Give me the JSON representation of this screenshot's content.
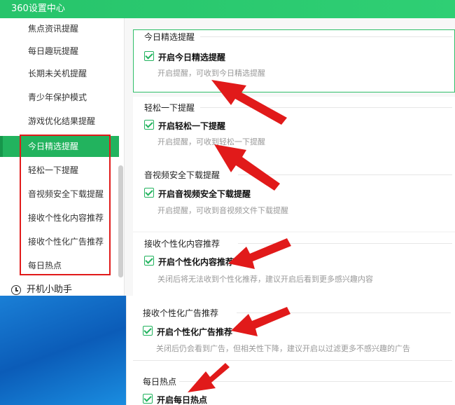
{
  "window": {
    "title": "360设置中心"
  },
  "sidebar": {
    "items": [
      {
        "label": "焦点资讯提醒",
        "active": false
      },
      {
        "label": "每日趣玩提醒",
        "active": false
      },
      {
        "label": "长期未关机提醒",
        "active": false
      },
      {
        "label": "青少年保护模式",
        "active": false
      },
      {
        "label": "游戏优化结果提醒",
        "active": false
      },
      {
        "label": "今日精选提醒",
        "active": true
      },
      {
        "label": "轻松一下提醒",
        "active": false
      },
      {
        "label": "音视频安全下载提醒",
        "active": false
      },
      {
        "label": "接收个性化内容推荐",
        "active": false
      },
      {
        "label": "接收个性化广告推荐",
        "active": false
      },
      {
        "label": "每日热点",
        "active": false
      }
    ],
    "assistant_label": "开机小助手"
  },
  "sections": [
    {
      "title": "今日精选提醒",
      "option": "开启今日精选提醒",
      "checked": true,
      "desc": "开启提醒，可收到今日精选提醒"
    },
    {
      "title": "轻松一下提醒",
      "option": "开启轻松一下提醒",
      "checked": true,
      "desc": "开启提醒，可收到轻松一下提醒"
    },
    {
      "title": "音视频安全下载提醒",
      "option": "开启音视频安全下载提醒",
      "checked": true,
      "desc": "开启提醒，可收到音视频文件下载提醒"
    },
    {
      "title": "接收个性化内容推荐",
      "option": "开启个性化内容推荐",
      "checked": true,
      "desc": "关闭后将无法收到个性化推荐，建议开启后看到更多感兴趣内容"
    },
    {
      "title": "接收个性化广告推荐",
      "option": "开启个性化广告推荐",
      "checked": true,
      "desc": "关闭后仍会看到广告，但相关性下降，建议开启以过滤更多不感兴趣的广告"
    },
    {
      "title": "每日热点",
      "option": "开启每日热点",
      "checked": true,
      "desc": ""
    }
  ],
  "colors": {
    "accent": "#22b35e",
    "annotation_red": "#e11a1a"
  }
}
